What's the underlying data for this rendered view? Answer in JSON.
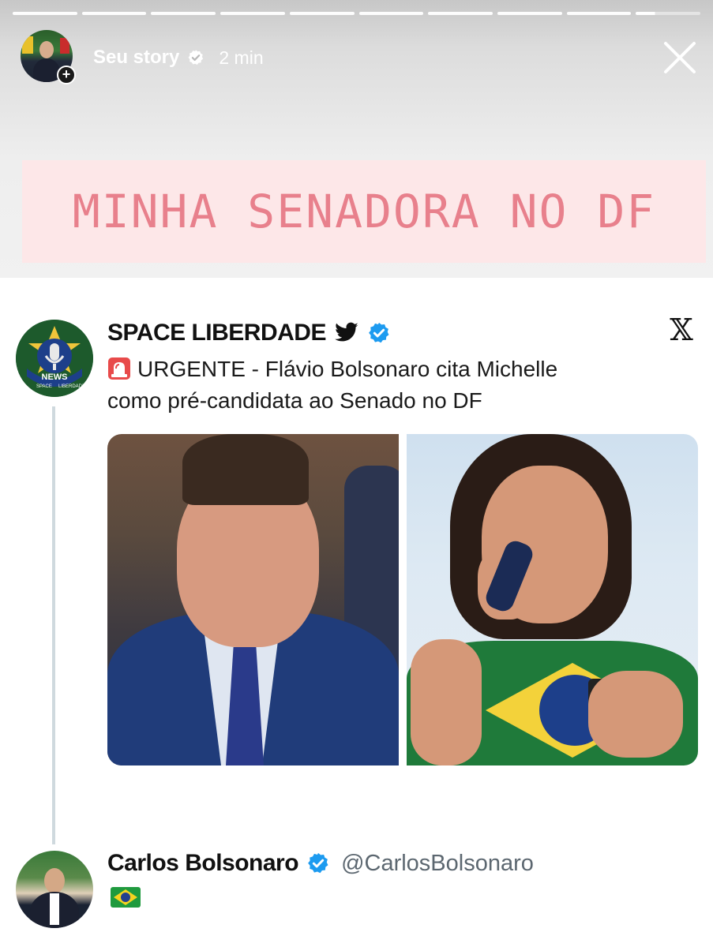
{
  "story": {
    "progress_segments": 10,
    "current_segment": 10,
    "current_segment_progress": 0.3,
    "username": "Seu story",
    "verified": true,
    "time": "2 min",
    "banner_text": "MINHA SENADORA NO DF"
  },
  "tweet": {
    "account_name": "SPACE LIBERDADE",
    "avatar_text": [
      "NEWS",
      "SPACE",
      "LIBERDADE"
    ],
    "icons": [
      "twitter-bird-icon",
      "verified-badge-icon",
      "x-logo-icon",
      "siren-emoji-icon"
    ],
    "x_logo": "𝕏",
    "text_line1": "URGENTE - Flávio Bolsonaro cita Michelle",
    "text_line2": "como pré-candidata ao Senado no DF",
    "media_count": 2
  },
  "reply": {
    "account_name": "Carlos Bolsonaro",
    "handle": "@CarlosBolsonaro",
    "verified": true,
    "content_emoji": "brazil-flag"
  },
  "colors": {
    "banner_bg": "#fde7e8",
    "banner_text": "#e8808c",
    "verified_blue": "#1d9bf0",
    "thread_line": "#cfd9de"
  }
}
